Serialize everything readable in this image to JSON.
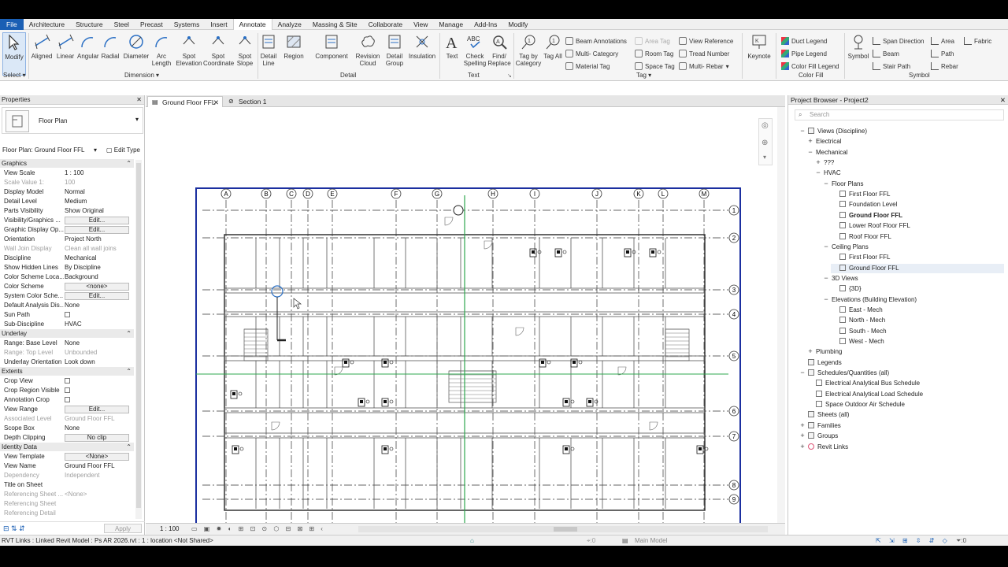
{
  "menu": [
    "File",
    "Architecture",
    "Structure",
    "Steel",
    "Precast",
    "Systems",
    "Insert",
    "Annotate",
    "Analyze",
    "Massing & Site",
    "Collaborate",
    "View",
    "Manage",
    "Add-Ins",
    "Modify"
  ],
  "ribbon": {
    "modify": "Modify",
    "select": "Select",
    "dimension": {
      "items": [
        "Aligned",
        "Linear",
        "Angular",
        "Radial",
        "Diameter",
        "Arc Length",
        "Spot Elevation",
        "Spot Coordinate",
        "Spot Slope"
      ],
      "label": "Dimension"
    },
    "detail": {
      "items": [
        "Detail Line",
        "Region",
        "Component",
        "Revision Cloud",
        "Detail Group",
        "Insulation"
      ],
      "label": "Detail"
    },
    "text": {
      "items": [
        "Text",
        "Check Spelling",
        "Find/ Replace"
      ],
      "label": "Text"
    },
    "tag": {
      "items": [
        "Tag by Category",
        "Tag All"
      ],
      "small": [
        "Beam Annotations",
        "Multi- Category",
        "Material Tag",
        "Area Tag",
        "Room Tag",
        "Space Tag",
        "View Reference",
        "Tread Number",
        "Multi- Rebar"
      ],
      "label": "Tag"
    },
    "keynote": "Keynote",
    "colorfill": {
      "small": [
        "Duct Legend",
        "Pipe Legend",
        "Color Fill Legend"
      ],
      "label": "Color Fill"
    },
    "symbol": {
      "big": "Symbol",
      "small": [
        "Span Direction",
        "Beam",
        "Stair Path",
        "Area",
        "Path",
        "Rebar",
        "Fabric"
      ],
      "label": "Symbol"
    }
  },
  "properties": {
    "title": "Properties",
    "type": "Floor Plan",
    "selector": "Floor Plan: Ground Floor FFL",
    "edit_type": "Edit Type",
    "sections": {
      "graphics": "Graphics",
      "underlay": "Underlay",
      "extents": "Extents",
      "identity": "Identity Data"
    },
    "rows": [
      {
        "k": "View Scale",
        "v": "1 : 100"
      },
      {
        "k": "Scale Value    1:",
        "v": "100"
      },
      {
        "k": "Display Model",
        "v": "Normal"
      },
      {
        "k": "Detail Level",
        "v": "Medium"
      },
      {
        "k": "Parts Visibility",
        "v": "Show Original"
      },
      {
        "k": "Visibility/Graphics ...",
        "v": "Edit..."
      },
      {
        "k": "Graphic Display Op...",
        "v": "Edit..."
      },
      {
        "k": "Orientation",
        "v": "Project North"
      },
      {
        "k": "Wall Join Display",
        "v": "Clean all wall joins"
      },
      {
        "k": "Discipline",
        "v": "Mechanical"
      },
      {
        "k": "Show Hidden Lines",
        "v": "By Discipline"
      },
      {
        "k": "Color Scheme Loca...",
        "v": "Background"
      },
      {
        "k": "Color Scheme",
        "v": "<none>"
      },
      {
        "k": "System Color Sche...",
        "v": "Edit..."
      },
      {
        "k": "Default Analysis Dis...",
        "v": "None"
      },
      {
        "k": "Sun Path",
        "v": ""
      },
      {
        "k": "Sub-Discipline",
        "v": "HVAC"
      },
      {
        "k": "Range: Base Level",
        "v": "None"
      },
      {
        "k": "Range: Top Level",
        "v": "Unbounded"
      },
      {
        "k": "Underlay Orientation",
        "v": "Look down"
      },
      {
        "k": "Crop View",
        "v": ""
      },
      {
        "k": "Crop Region Visible",
        "v": ""
      },
      {
        "k": "Annotation Crop",
        "v": ""
      },
      {
        "k": "View Range",
        "v": "Edit..."
      },
      {
        "k": "Associated Level",
        "v": "Ground Floor FFL"
      },
      {
        "k": "Scope Box",
        "v": "None"
      },
      {
        "k": "Depth Clipping",
        "v": "No clip"
      },
      {
        "k": "View Template",
        "v": "<None>"
      },
      {
        "k": "View Name",
        "v": "Ground Floor FFL"
      },
      {
        "k": "Dependency",
        "v": "Independent"
      },
      {
        "k": "Title on Sheet",
        "v": ""
      },
      {
        "k": "Referencing Sheet ...",
        "v": "<None>"
      },
      {
        "k": "Referencing Sheet",
        "v": ""
      },
      {
        "k": "Referencing Detail",
        "v": ""
      }
    ],
    "apply": "Apply"
  },
  "view": {
    "tabs": [
      "Ground Floor FFL",
      "Section 1"
    ],
    "scale": "1 : 100",
    "grid_letters": [
      "A",
      "B",
      "C",
      "D",
      "E",
      "F",
      "G",
      "H",
      "I",
      "J",
      "K",
      "L",
      "M"
    ],
    "grid_numbers": [
      "1",
      "2",
      "3",
      "4",
      "5",
      "6",
      "7",
      "8",
      "9"
    ]
  },
  "browser": {
    "title": "Project Browser - Project2",
    "search_placeholder": "Search",
    "nodes": [
      "Views (Discipline)",
      "Electrical",
      "Mechanical",
      "???",
      "HVAC",
      "Floor Plans",
      "First Floor FFL",
      "Foundation Level",
      "Ground Floor FFL",
      "Lower Roof Floor FFL",
      "Roof Floor FFL",
      "Ceiling Plans",
      "First Floor FFL",
      "Ground Floor FFL",
      "3D Views",
      "{3D}",
      "Elevations (Building Elevation)",
      "East - Mech",
      "North - Mech",
      "South - Mech",
      "West - Mech",
      "Plumbing",
      "Legends",
      "Schedules/Quantities (all)",
      "Electrical Analytical Bus Schedule",
      "Electrical Analytical Load Schedule",
      "Space Outdoor Air Schedule",
      "Sheets (all)",
      "Families",
      "Groups",
      "Revit Links"
    ]
  },
  "status": {
    "text": "RVT Links : Linked Revit Model : Ps AR 2026.rvt : 1 : location <Not Shared>",
    "coord": ":0",
    "model": "Main Model",
    "filter": ":0"
  },
  "colors": {
    "accent": "#1a5fb4",
    "grid_green": "#2fa84f",
    "crop_blue": "#1b2fa0"
  }
}
